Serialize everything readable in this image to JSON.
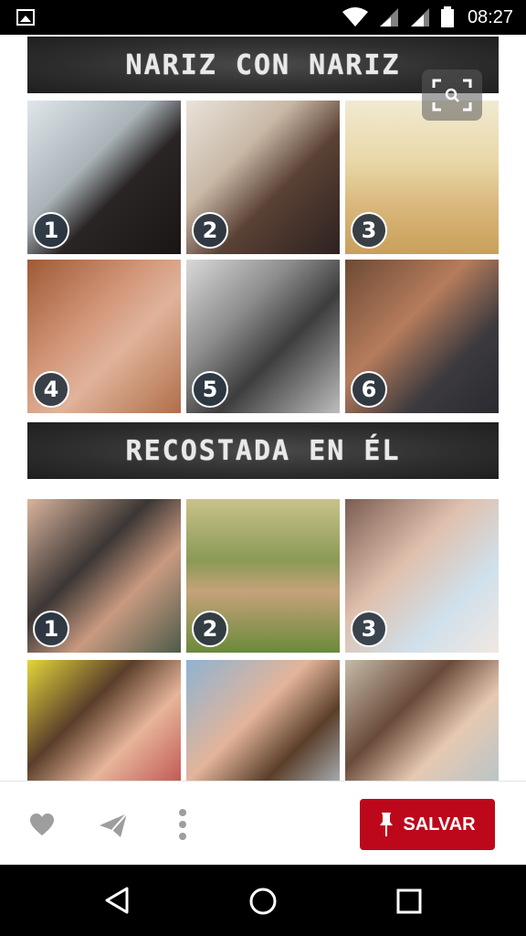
{
  "status_bar": {
    "time": "08:27"
  },
  "sections": [
    {
      "title": "NARIZ CON NARIZ",
      "numbers": [
        "1",
        "2",
        "3",
        "4",
        "5",
        "6"
      ]
    },
    {
      "title": "RECOSTADA EN ÉL",
      "numbers": [
        "1",
        "2",
        "3"
      ]
    }
  ],
  "actions": {
    "save_label": "SALVAR"
  },
  "colors": {
    "save_button": "#bd081c",
    "banner": "#2d2d2d"
  },
  "icons": {
    "status": [
      "image-icon",
      "wifi-icon",
      "signal-icon",
      "signal-icon",
      "battery-icon"
    ],
    "action": [
      "heart-icon",
      "send-icon",
      "more-icon",
      "pin-icon"
    ],
    "nav": [
      "back-icon",
      "home-icon",
      "recents-icon"
    ]
  }
}
